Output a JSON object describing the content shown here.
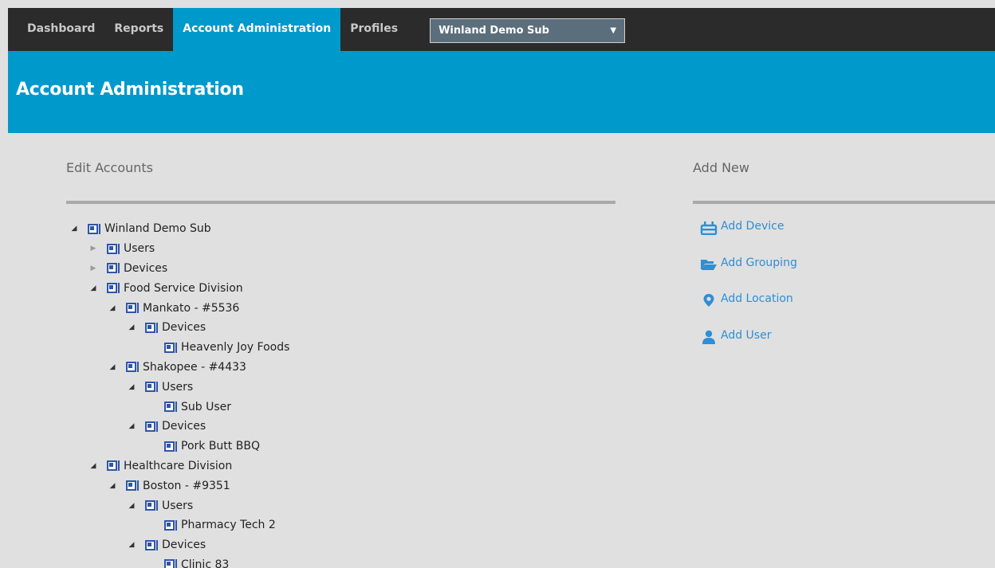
{
  "nav": {
    "tabs": [
      {
        "label": "Dashboard",
        "active": false
      },
      {
        "label": "Reports",
        "active": false
      },
      {
        "label": "Account Administration",
        "active": true
      },
      {
        "label": "Profiles",
        "active": false
      }
    ],
    "account_select": {
      "value": "Winland Demo Sub",
      "caret": "▼"
    }
  },
  "header": {
    "title": "Account Administration"
  },
  "edit_accounts": {
    "title": "Edit Accounts",
    "tree": [
      {
        "label": "Winland Demo Sub",
        "depth": 0,
        "toggle": "expanded"
      },
      {
        "label": "Users",
        "depth": 1,
        "toggle": "collapsed"
      },
      {
        "label": "Devices",
        "depth": 1,
        "toggle": "collapsed"
      },
      {
        "label": "Food Service Division",
        "depth": 1,
        "toggle": "expanded"
      },
      {
        "label": "Mankato - #5536",
        "depth": 2,
        "toggle": "expanded"
      },
      {
        "label": "Devices",
        "depth": 3,
        "toggle": "expanded"
      },
      {
        "label": "Heavenly Joy Foods",
        "depth": 4,
        "toggle": "none"
      },
      {
        "label": "Shakopee - #4433",
        "depth": 2,
        "toggle": "expanded"
      },
      {
        "label": "Users",
        "depth": 3,
        "toggle": "expanded"
      },
      {
        "label": "Sub User",
        "depth": 4,
        "toggle": "none"
      },
      {
        "label": "Devices",
        "depth": 3,
        "toggle": "expanded"
      },
      {
        "label": "Pork Butt BBQ",
        "depth": 4,
        "toggle": "none"
      },
      {
        "label": "Healthcare Division",
        "depth": 1,
        "toggle": "expanded"
      },
      {
        "label": "Boston - #9351",
        "depth": 2,
        "toggle": "expanded"
      },
      {
        "label": "Users",
        "depth": 3,
        "toggle": "expanded"
      },
      {
        "label": "Pharmacy Tech 2",
        "depth": 4,
        "toggle": "none"
      },
      {
        "label": "Devices",
        "depth": 3,
        "toggle": "expanded"
      },
      {
        "label": "Clinic 83",
        "depth": 4,
        "toggle": "none"
      }
    ]
  },
  "add_new": {
    "title": "Add New",
    "items": [
      {
        "label": "Add Device",
        "icon": "device-icon"
      },
      {
        "label": "Add Grouping",
        "icon": "folder-open-icon"
      },
      {
        "label": "Add Location",
        "icon": "map-pin-icon"
      },
      {
        "label": "Add User",
        "icon": "user-icon"
      }
    ]
  },
  "colors": {
    "nav_bg": "#2b2b2b",
    "accent": "#0099cc",
    "page_bg": "#e0e0e0",
    "link": "#2d8fd5",
    "tree_icon": "#2f55a8",
    "rule": "#a9a9a9"
  }
}
